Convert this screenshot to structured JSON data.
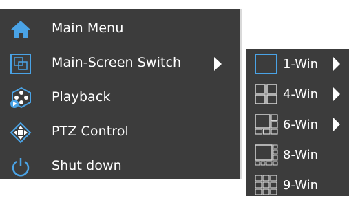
{
  "colors": {
    "menu_background": "#3c3c3c",
    "icon_accent": "#4aa3e6",
    "text": "#ffffff"
  },
  "main_menu": {
    "items": [
      {
        "label": "Main Menu",
        "icon": "home-icon",
        "has_submenu": false
      },
      {
        "label": "Main-Screen Switch",
        "icon": "screen-switch-icon",
        "has_submenu": true
      },
      {
        "label": "Playback",
        "icon": "playback-reel-icon",
        "has_submenu": false
      },
      {
        "label": "PTZ Control",
        "icon": "ptz-control-icon",
        "has_submenu": false
      },
      {
        "label": "Shut down",
        "icon": "power-icon",
        "has_submenu": false
      }
    ]
  },
  "submenu": {
    "items": [
      {
        "label": "1-Win",
        "icon": "layout-1-win-icon",
        "has_submenu": true
      },
      {
        "label": "4-Win",
        "icon": "layout-4-win-icon",
        "has_submenu": true
      },
      {
        "label": "6-Win",
        "icon": "layout-6-win-icon",
        "has_submenu": true
      },
      {
        "label": "8-Win",
        "icon": "layout-8-win-icon",
        "has_submenu": false
      },
      {
        "label": "9-Win",
        "icon": "layout-9-win-icon",
        "has_submenu": false
      }
    ]
  }
}
